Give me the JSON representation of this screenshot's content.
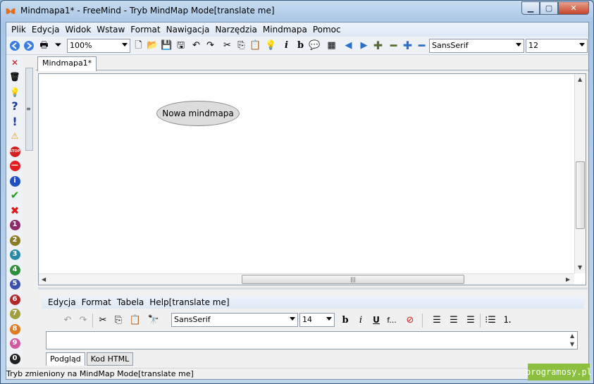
{
  "window": {
    "title": "Mindmapa1* - FreeMind - Tryb MindMap Mode[translate me]"
  },
  "menu": [
    "Plik",
    "Edycja",
    "Widok",
    "Wstaw",
    "Format",
    "Nawigacja",
    "Narzędzia",
    "Mindmapa",
    "Pomoc"
  ],
  "toolbar": {
    "zoom": "100%",
    "font": "SansSerif",
    "size": "12"
  },
  "tab": {
    "label": "Mindmapa1*"
  },
  "map": {
    "root_node": "Nowa mindmapa"
  },
  "editor": {
    "menu": [
      "Edycja",
      "Format",
      "Tabela",
      "Help[translate me]"
    ],
    "font": "SansSerif",
    "size": "14",
    "tabs": [
      "Podgląd",
      "Kod HTML"
    ]
  },
  "status": "Tryb zmieniony na MindMap Mode[translate me]",
  "watermark": "programosy.pl",
  "icons": {
    "numbers": [
      "1",
      "2",
      "3",
      "4",
      "5",
      "6",
      "7",
      "8",
      "9",
      "0"
    ],
    "number_colors": [
      "#8b2d6a",
      "#8a7d25",
      "#2a8aa6",
      "#2e8f3a",
      "#3a4fb0",
      "#b02a2a",
      "#a0a040",
      "#e07a20",
      "#d05aa0",
      "#222222"
    ]
  }
}
